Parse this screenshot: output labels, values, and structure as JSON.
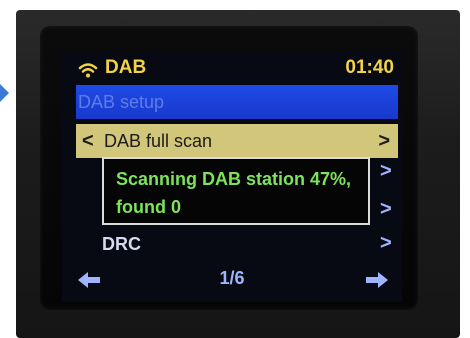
{
  "status_bar": {
    "wifi_icon": "wifi-icon",
    "title": "DAB",
    "time": "01:40",
    "accent_color": "#f4d247"
  },
  "menu": {
    "section_title": "DAB setup",
    "selected_item": {
      "label": "DAB full scan",
      "left_chevron": "<",
      "right_chevron": ">"
    },
    "popup": {
      "lines": [
        "Scanning DAB station 47%,",
        "found 0"
      ],
      "scan_progress_percent": 47,
      "found_count": 0
    },
    "items": [
      {
        "label": "DRC",
        "chevron": ">"
      }
    ]
  },
  "footer": {
    "page": "1/6",
    "left_icon": "left-arrow-icon",
    "right_icon": "right-arrow-icon"
  },
  "colors": {
    "header_bar": "#1f4be6",
    "selected_bar": "#d2c67a",
    "popup_text": "#7de35a",
    "nav": "#9fb4ff"
  }
}
